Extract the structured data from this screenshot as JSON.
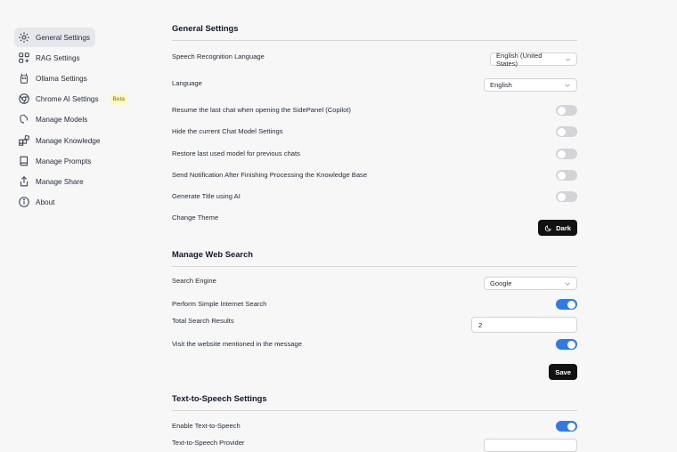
{
  "sidebar": {
    "items": [
      {
        "label": "General Settings",
        "icon": "gear-icon",
        "active": true
      },
      {
        "label": "RAG Settings",
        "icon": "rag-icon"
      },
      {
        "label": "Ollama Settings",
        "icon": "ollama-icon"
      },
      {
        "label": "Chrome AI Settings",
        "icon": "chrome-icon",
        "badge": "Beta"
      },
      {
        "label": "Manage Models",
        "icon": "brain-icon"
      },
      {
        "label": "Manage Knowledge",
        "icon": "blocks-icon"
      },
      {
        "label": "Manage Prompts",
        "icon": "book-icon"
      },
      {
        "label": "Manage Share",
        "icon": "share-icon"
      },
      {
        "label": "About",
        "icon": "info-icon"
      }
    ]
  },
  "general": {
    "title": "General Settings",
    "speech_language_label": "Speech Recognition Language",
    "speech_language_value": "English (United States)",
    "language_label": "Language",
    "language_value": "English",
    "toggles": [
      {
        "label": "Resume the last chat when opening the SidePanel (Copilot)",
        "on": false
      },
      {
        "label": "Hide the current Chat Model Settings",
        "on": false
      },
      {
        "label": "Restore last used model for previous chats",
        "on": false
      },
      {
        "label": "Send Notification After Finishing Processing the Knowledge Base",
        "on": false
      },
      {
        "label": "Generate Title using AI",
        "on": false
      }
    ],
    "theme_label": "Change Theme",
    "theme_button": "Dark"
  },
  "web_search": {
    "title": "Manage Web Search",
    "engine_label": "Search Engine",
    "engine_value": "Google",
    "simple_search_label": "Perform Simple Internet Search",
    "simple_search_on": true,
    "total_results_label": "Total Search Results",
    "total_results_value": "2",
    "visit_website_label": "Visit the website mentioned in the message",
    "visit_website_on": true,
    "save_button": "Save"
  },
  "tts": {
    "title": "Text-to-Speech Settings",
    "enable_label": "Enable Text-to-Speech",
    "enable_on": true,
    "next_label_partial": "Text-to-Speech Provider"
  },
  "colors": {
    "toggle_on": "#2f7ae5",
    "toggle_off": "#d4d4d8",
    "dark_button": "#111111",
    "background": "#f7f7f8"
  }
}
